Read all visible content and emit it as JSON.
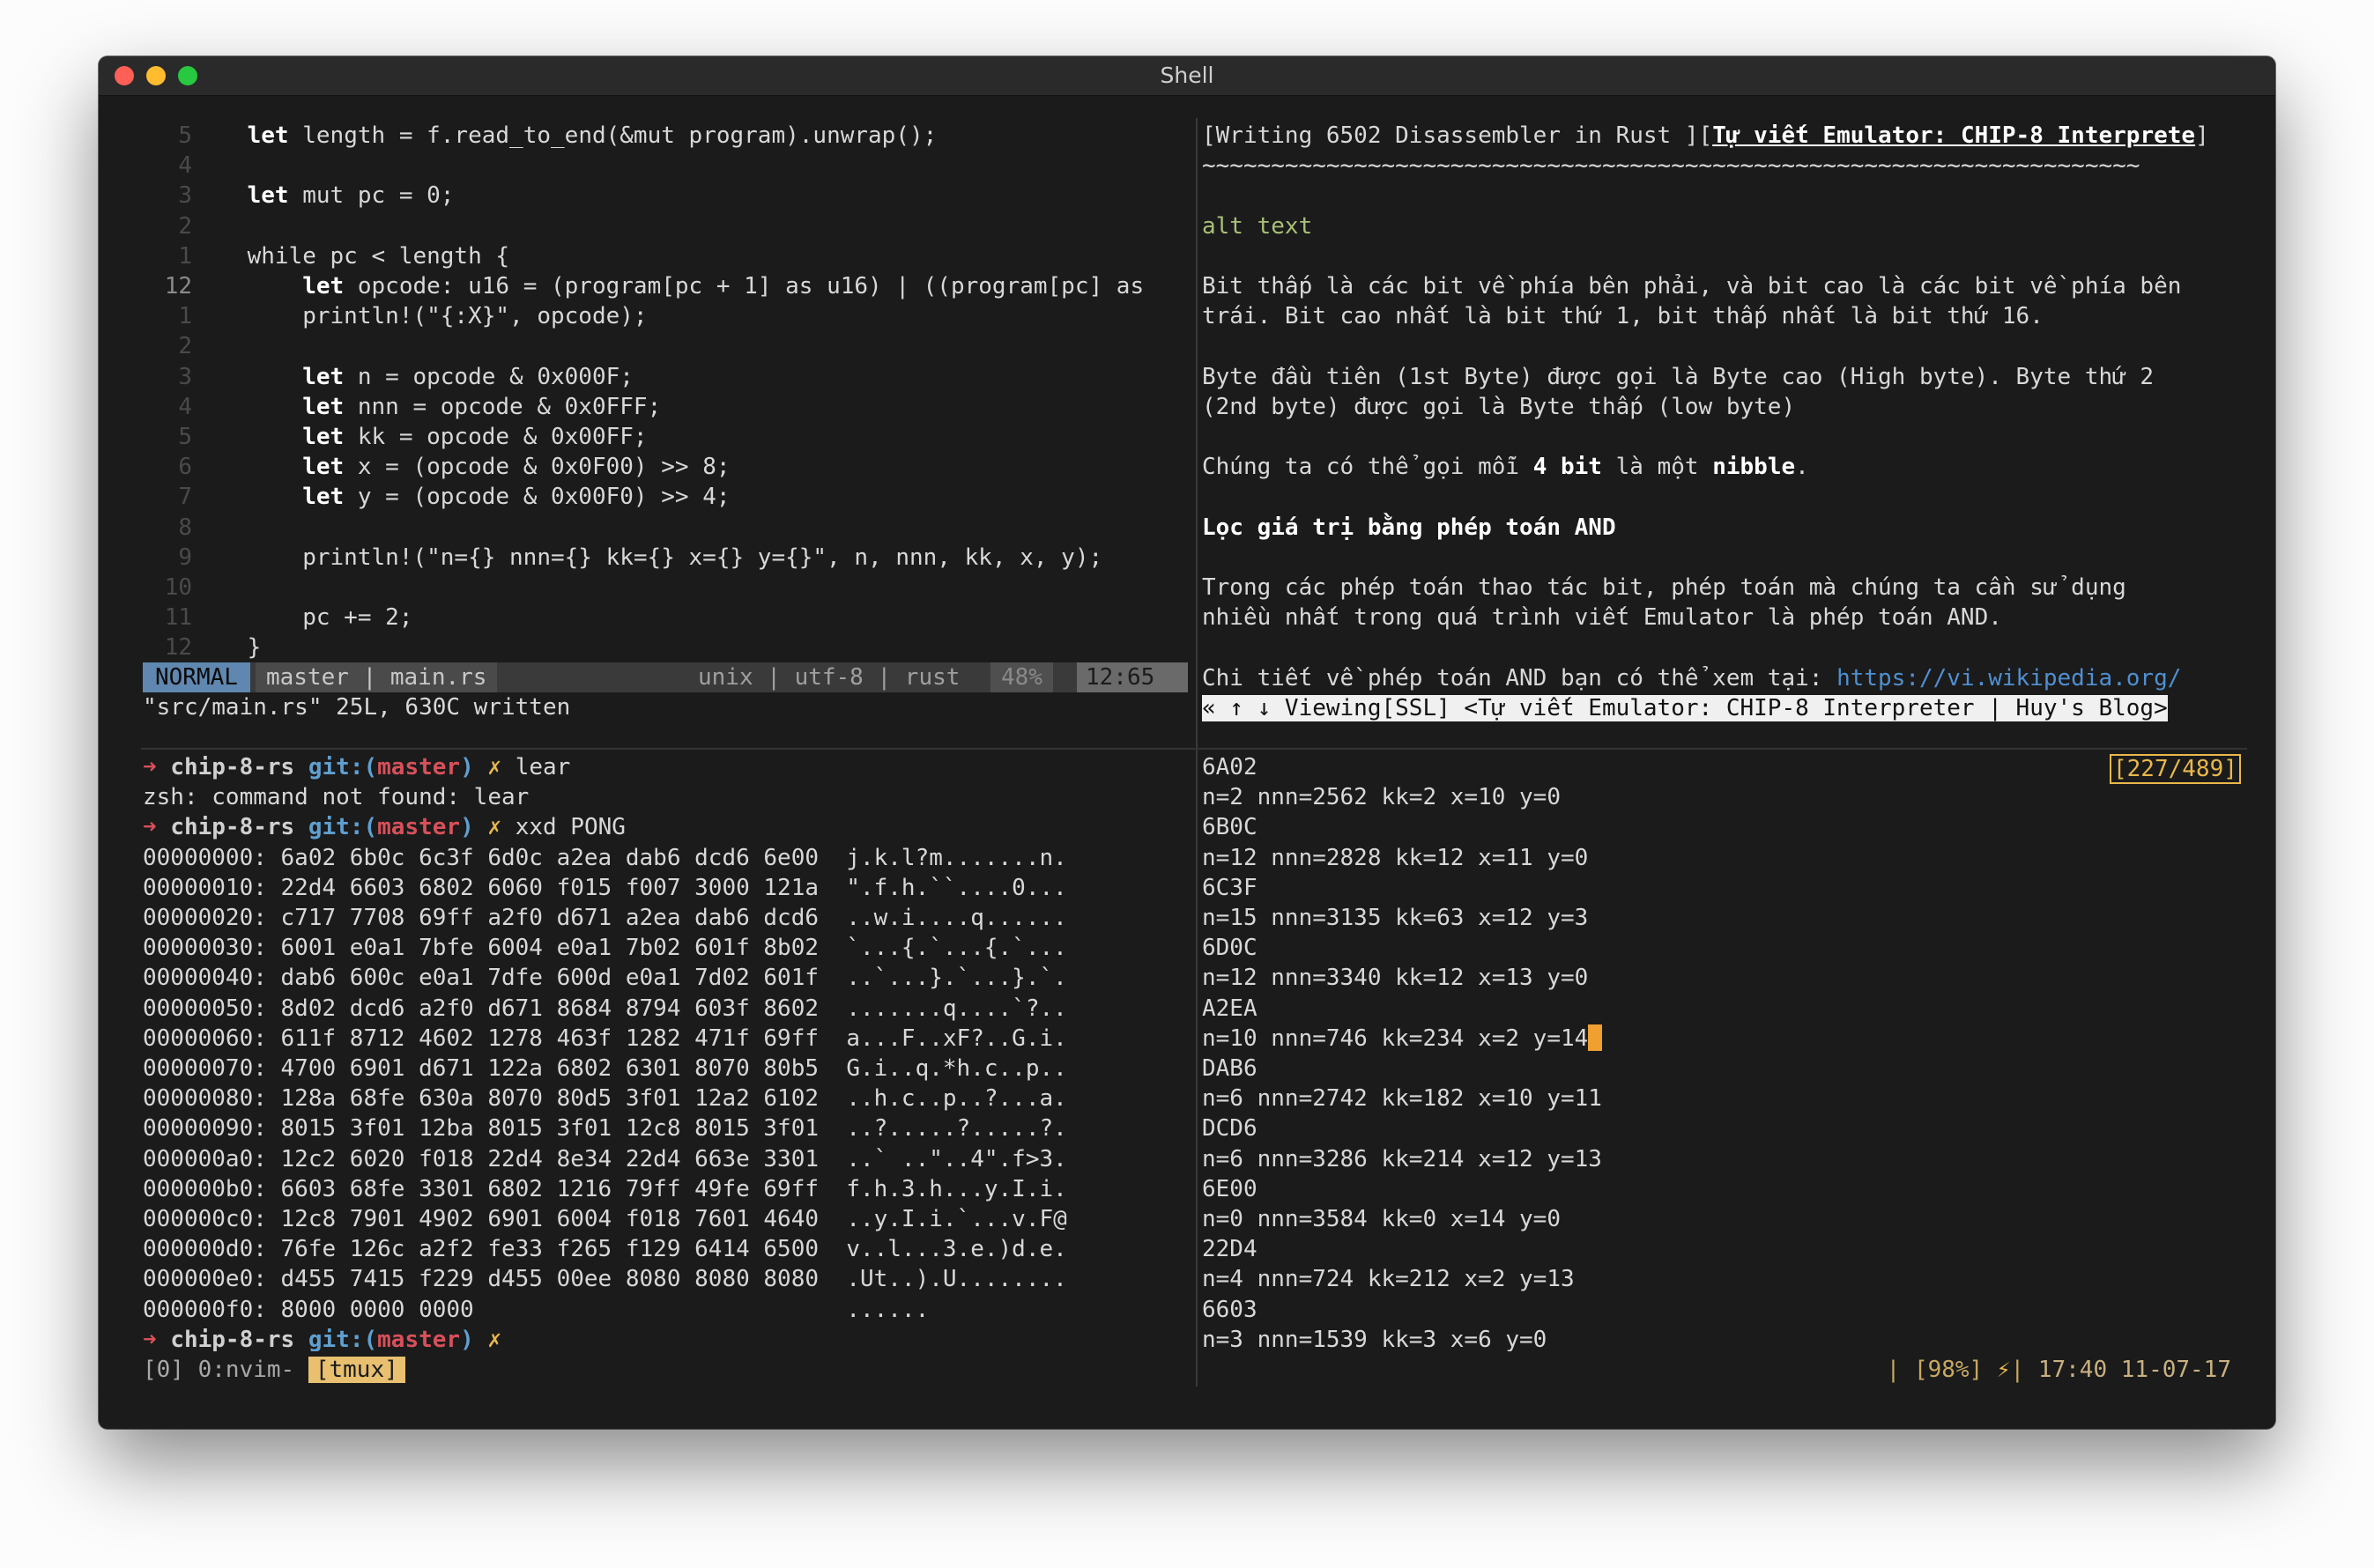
{
  "window": {
    "title": "Shell"
  },
  "editor": {
    "lines": [
      {
        "num": "5",
        "code": "    let length = f.read_to_end(&mut program).unwrap();"
      },
      {
        "num": "4",
        "code": ""
      },
      {
        "num": "3",
        "code": "    let mut pc = 0;"
      },
      {
        "num": "2",
        "code": ""
      },
      {
        "num": "1",
        "code": "    while pc < length {"
      },
      {
        "num": "12",
        "code": "        let opcode: u16 = (program[pc + 1] as u16) | ((program[pc] as"
      },
      {
        "num": "1",
        "code": "        println!(\"{:X}\", opcode);"
      },
      {
        "num": "2",
        "code": ""
      },
      {
        "num": "3",
        "code": "        let n = opcode & 0x000F;"
      },
      {
        "num": "4",
        "code": "        let nnn = opcode & 0x0FFF;"
      },
      {
        "num": "5",
        "code": "        let kk = opcode & 0x00FF;"
      },
      {
        "num": "6",
        "code": "        let x = (opcode & 0x0F00) >> 8;"
      },
      {
        "num": "7",
        "code": "        let y = (opcode & 0x00F0) >> 4;"
      },
      {
        "num": "8",
        "code": ""
      },
      {
        "num": "9",
        "code": "        println!(\"n={} nnn={} kk={} x={} y={}\", n, nnn, kk, x, y);"
      },
      {
        "num": "10",
        "code": ""
      },
      {
        "num": "11",
        "code": "        pc += 2;"
      },
      {
        "num": "12",
        "code": "    }"
      }
    ],
    "status": {
      "mode": "NORMAL",
      "branch_file": "master | main.rs",
      "fileinfo": "unix | utf-8 | rust",
      "percent": "48%",
      "position": "12:65"
    },
    "message": "\"src/main.rs\" 25L, 630C written"
  },
  "shell": {
    "prompt": {
      "arrow": "➜",
      "dir": "chip-8-rs",
      "git": "git:",
      "branch": "master",
      "dirty": "✗"
    },
    "cmd1": "lear",
    "error": "zsh: command not found: lear",
    "cmd2": "xxd PONG",
    "hexdump": [
      "00000000: 6a02 6b0c 6c3f 6d0c a2ea dab6 dcd6 6e00  j.k.l?m.......n.",
      "00000010: 22d4 6603 6802 6060 f015 f007 3000 121a  \".f.h.``....0...",
      "00000020: c717 7708 69ff a2f0 d671 a2ea dab6 dcd6  ..w.i....q......",
      "00000030: 6001 e0a1 7bfe 6004 e0a1 7b02 601f 8b02  `...{.`...{.`...",
      "00000040: dab6 600c e0a1 7dfe 600d e0a1 7d02 601f  ..`...}.`...}.`.",
      "00000050: 8d02 dcd6 a2f0 d671 8684 8794 603f 8602  .......q....`?..",
      "00000060: 611f 8712 4602 1278 463f 1282 471f 69ff  a...F..xF?..G.i.",
      "00000070: 4700 6901 d671 122a 6802 6301 8070 80b5  G.i..q.*h.c..p..",
      "00000080: 128a 68fe 630a 8070 80d5 3f01 12a2 6102  ..h.c..p..?...a.",
      "00000090: 8015 3f01 12ba 8015 3f01 12c8 8015 3f01  ..?.....?.....?.",
      "000000a0: 12c2 6020 f018 22d4 8e34 22d4 663e 3301  ..` ..\"..4\".f>3.",
      "000000b0: 6603 68fe 3301 6802 1216 79ff 49fe 69ff  f.h.3.h...y.I.i.",
      "000000c0: 12c8 7901 4902 6901 6004 f018 7601 4640  ..y.I.i.`...v.F@",
      "000000d0: 76fe 126c a2f2 fe33 f265 f129 6414 6500  v..l...3.e.)d.e.",
      "000000e0: d455 7415 f229 d455 00ee 8080 8080 8080  .Ut..).U........",
      "000000f0: 8000 0000 0000                           ......"
    ]
  },
  "browser": {
    "tab1": "[Writing 6502 Disassembler in Rust ]",
    "tab2_bracket_open": "[",
    "tab2": "Tự viết Emulator: CHIP-8 Interprete",
    "tab2_bracket_close": "]",
    "rule": "~~~~~~~~~~~~~~~~~~~~~~~~~~~~~~~~~~~~~~~~~~~~~~~~~~~~~~~~~~~~~~~~~~~~",
    "alt": "alt text",
    "p1a": "Bit thấp là các bit về phía bên phải, và bit cao là các bit về phía bên",
    "p1b": "trái. Bit cao nhất là bit thứ 1, bit thấp nhất là bit thứ 16.",
    "p2a": "Byte đầu tiên (1st Byte) được gọi là Byte cao (High byte). Byte thứ 2",
    "p2b": "(2nd byte) được gọi là Byte thấp (low byte)",
    "p3_pre": "Chúng ta có thể gọi mỗi ",
    "p3_bold1": "4 bit",
    "p3_mid": " là một ",
    "p3_bold2": "nibble",
    "p3_post": ".",
    "heading": "Lọc giá trị bằng phép toán AND",
    "p4a": "Trong các phép toán thao tác bit, phép toán mà chúng ta cần sử dụng",
    "p4b": "nhiều nhất trong quá trình viết Emulator là phép toán AND.",
    "p5_pre": "Chi tiết về phép toán AND bạn có thể xem tại: ",
    "p5_url": "https://vi.wikipedia.org/",
    "statusline": "« ↑ ↓ Viewing[SSL] <Tự viết Emulator: CHIP-8 Interpreter | Huy's Blog>"
  },
  "output": {
    "counter": "[227/489]",
    "lines": [
      "6A02",
      "n=2 nnn=2562 kk=2 x=10 y=0",
      "6B0C",
      "n=12 nnn=2828 kk=12 x=11 y=0",
      "6C3F",
      "n=15 nnn=3135 kk=63 x=12 y=3",
      "6D0C",
      "n=12 nnn=3340 kk=12 x=13 y=0",
      "A2EA",
      "n=10 nnn=746 kk=234 x=2 y=14",
      "DAB6",
      "n=6 nnn=2742 kk=182 x=10 y=11",
      "DCD6",
      "n=6 nnn=3286 kk=214 x=12 y=13",
      "6E00",
      "n=0 nnn=3584 kk=0 x=14 y=0",
      "22D4",
      "n=4 nnn=724 kk=212 x=2 y=13",
      "6603",
      "n=3 nnn=1539 kk=3 x=6 y=0"
    ]
  },
  "tmux": {
    "session": "[0] 0:nvim- ",
    "active_window": "[tmux]",
    "right_sep": "| ",
    "battery": "[98%]",
    "bolt": "⚡",
    "bar": "| ",
    "time": "17:40 11-07-17"
  },
  "colors": {
    "background": "#1b1b1b",
    "mode_bg": "#5f87af",
    "accent_yellow": "#e8b84a",
    "prompt_red": "#d7505a",
    "git_blue": "#5f9fd0"
  }
}
